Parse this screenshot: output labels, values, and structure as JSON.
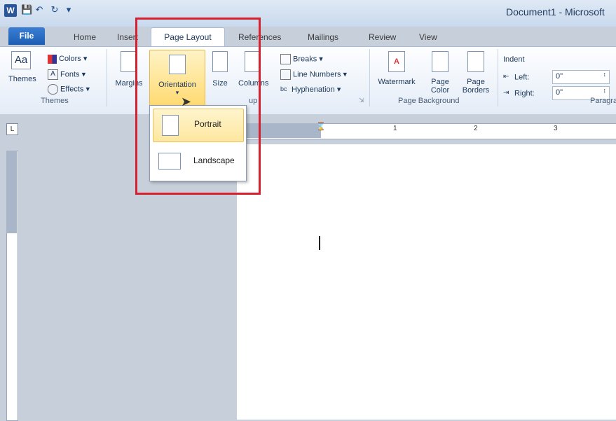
{
  "title_bar": {
    "app_icon": "W",
    "document_title": "Document1 - Microsoft"
  },
  "tabs": [
    {
      "label": "File"
    },
    {
      "label": "Home"
    },
    {
      "label": "Insert"
    },
    {
      "label": "Page Layout"
    },
    {
      "label": "References"
    },
    {
      "label": "Mailings"
    },
    {
      "label": "Review"
    },
    {
      "label": "View"
    }
  ],
  "ribbon": {
    "themes": {
      "themes": "Themes",
      "colors": "Colors",
      "fonts": "Fonts",
      "effects": "Effects",
      "group": "Themes"
    },
    "page_setup": {
      "margins": "Margins",
      "orientation": "Orientation",
      "size": "Size",
      "columns": "Columns",
      "breaks": "Breaks",
      "line_numbers": "Line Numbers",
      "hyphenation": "Hyphenation",
      "group": "up"
    },
    "page_background": {
      "watermark": "Watermark",
      "page_color_1": "Page",
      "page_color_2": "Color",
      "page_borders_1": "Page",
      "page_borders_2": "Borders",
      "group": "Page Background"
    },
    "paragraph": {
      "indent": "Indent",
      "left_label": "Left:",
      "left_value": "0\"",
      "right_label": "Right:",
      "right_value": "0\"",
      "group": "Paragra"
    }
  },
  "ruler": {
    "corner": "L",
    "marks": [
      "1",
      "2",
      "3"
    ]
  },
  "orientation_menu": {
    "items": [
      {
        "label": "Portrait",
        "selected": true
      },
      {
        "label": "Landscape",
        "selected": false
      }
    ]
  },
  "colors": {
    "highlight": "#d4202f",
    "file_tab": "#2a6bc4"
  }
}
